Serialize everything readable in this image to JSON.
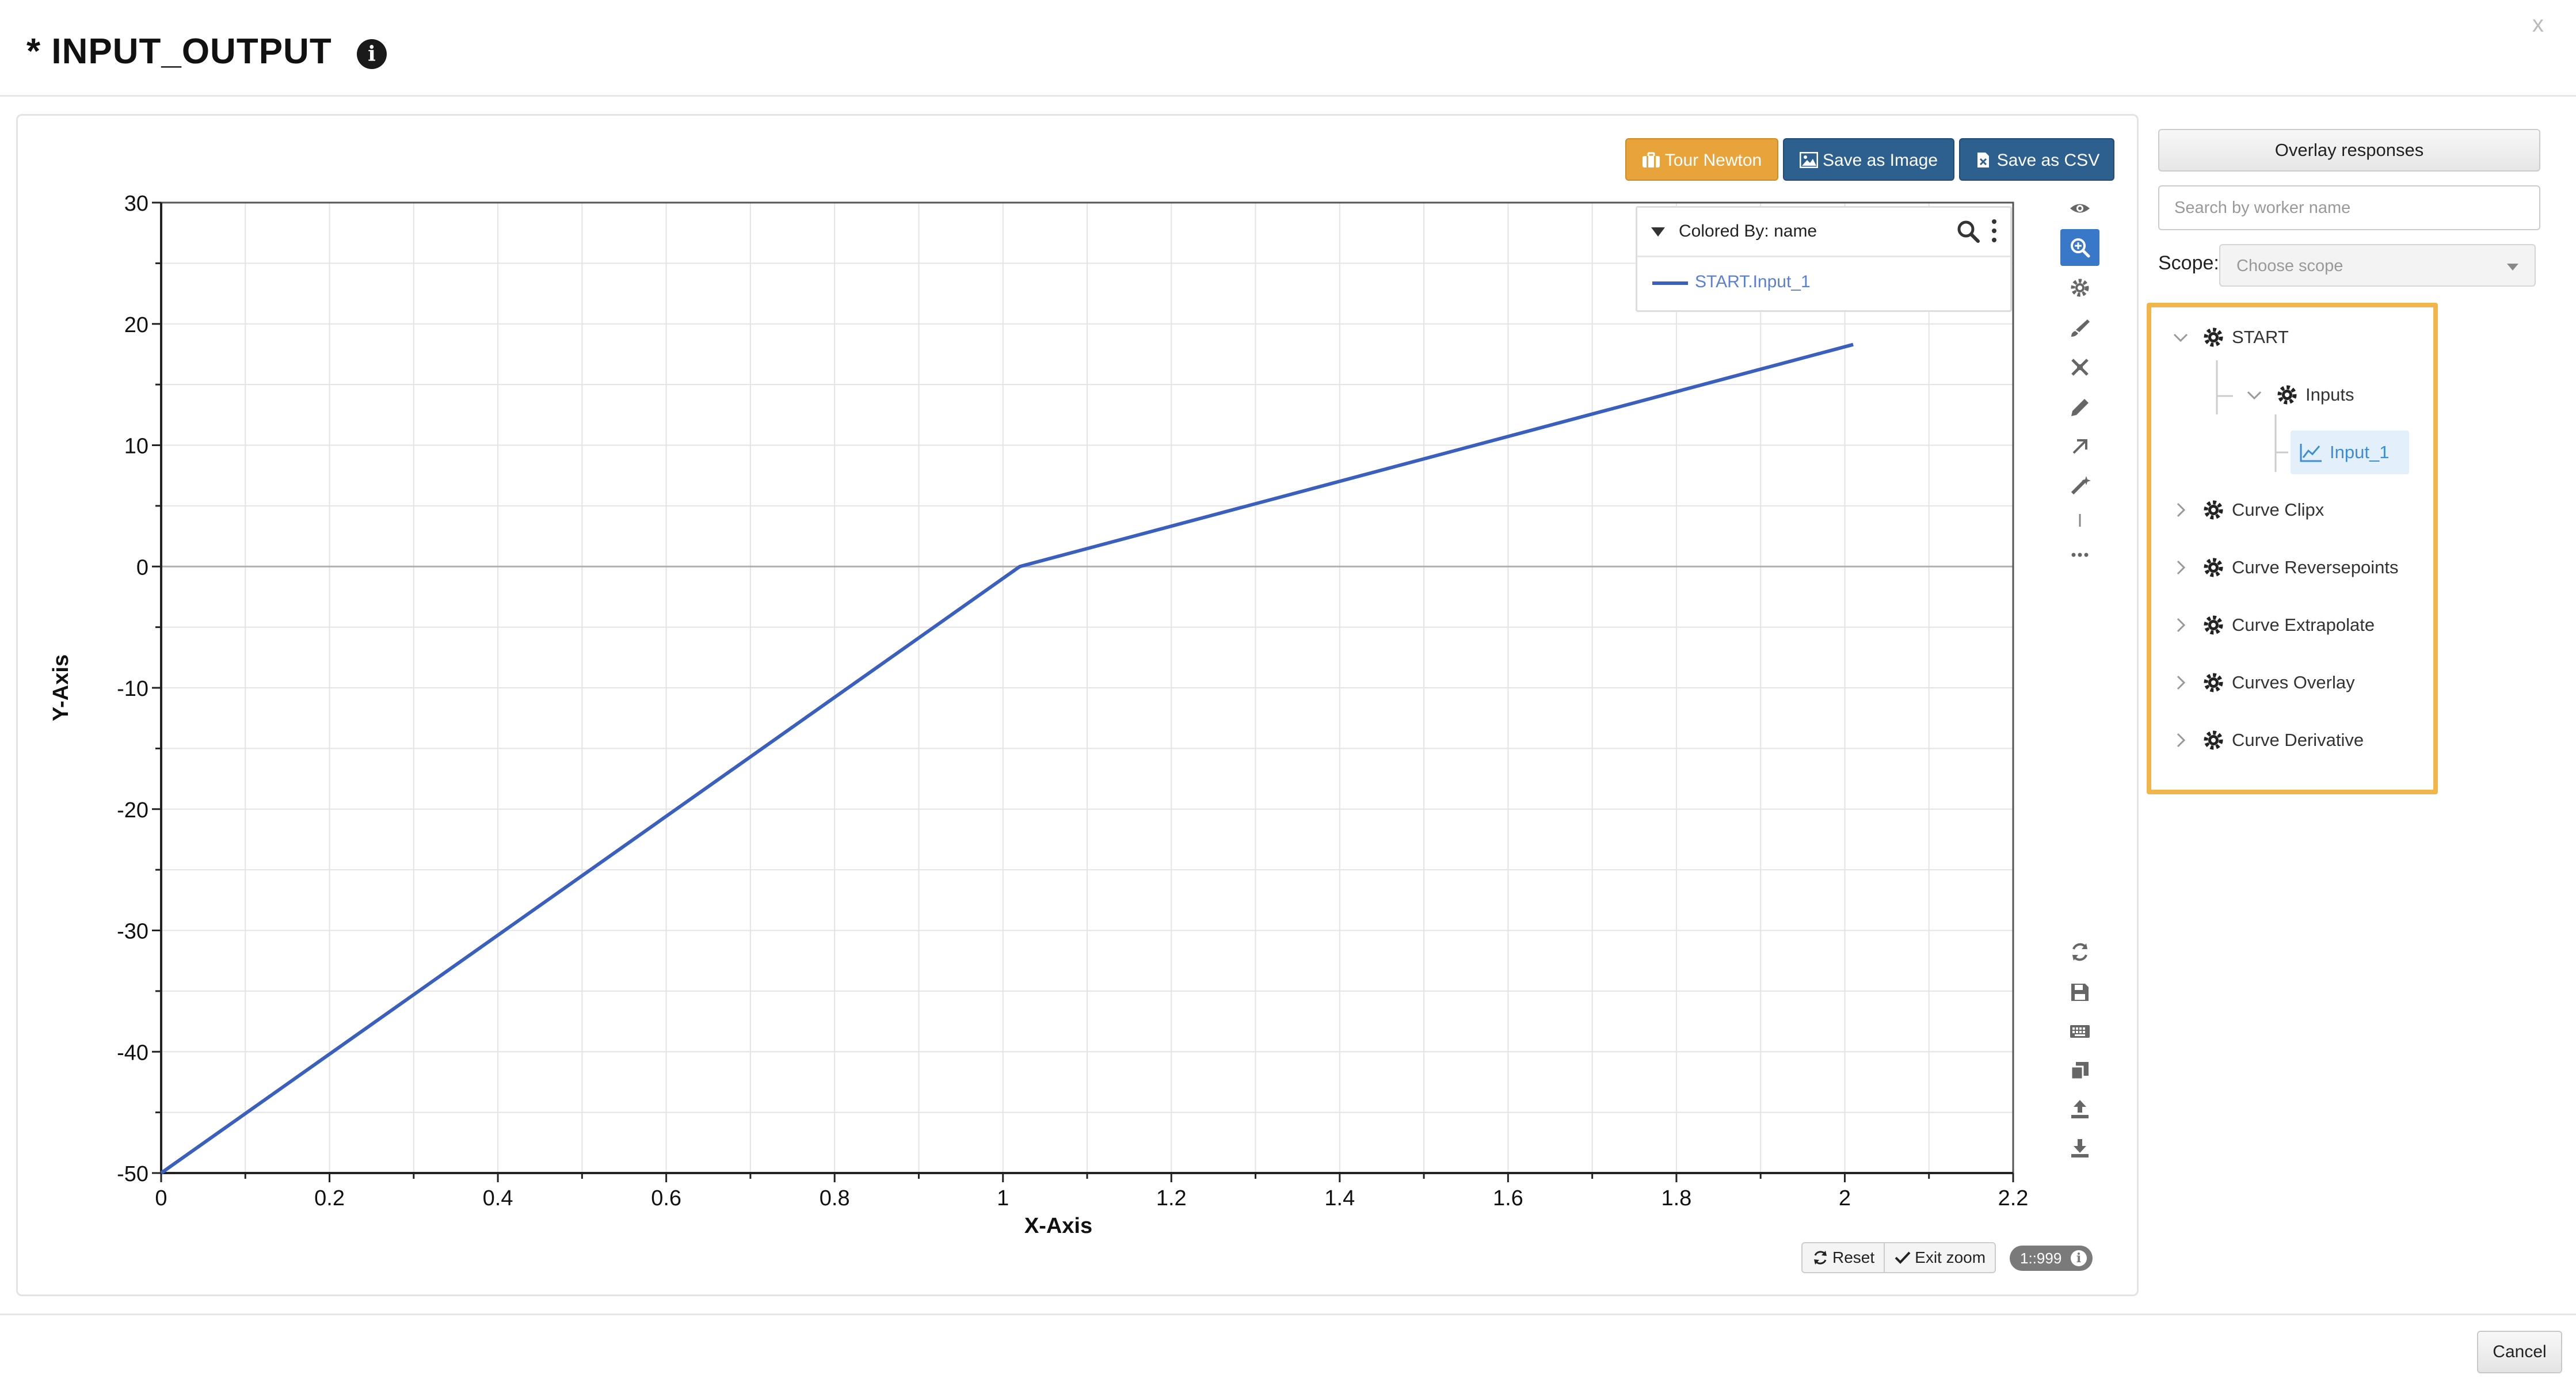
{
  "header": {
    "title": "* INPUT_OUTPUT",
    "info_glyph": "i",
    "close_label": "x"
  },
  "toolbar": {
    "tour_label": "Tour Newton",
    "save_image_label": "Save as Image",
    "save_csv_label": "Save as CSV"
  },
  "legend": {
    "title": "Colored By: name",
    "items": [
      {
        "label": "START.Input_1",
        "color": "#3a5fbf"
      }
    ]
  },
  "chart_controls": {
    "reset_label": "Reset",
    "exit_zoom_label": "Exit zoom",
    "ratio_label": "1::999"
  },
  "chart_data": {
    "type": "line",
    "xlabel": "X-Axis",
    "ylabel": "Y-Axis",
    "xlim": [
      0,
      2.2
    ],
    "ylim": [
      -50,
      30
    ],
    "xticks": [
      "0",
      "0.2",
      "0.4",
      "0.6",
      "0.8",
      "1",
      "1.2",
      "1.4",
      "1.6",
      "1.8",
      "2",
      "2.2"
    ],
    "yticks": [
      "30",
      "20",
      "10",
      "0",
      "-10",
      "-20",
      "-30",
      "-40",
      "-50"
    ],
    "grid": true,
    "legend_position": "top-right",
    "series": [
      {
        "name": "START.Input_1",
        "color": "#3a5fbf",
        "x": [
          0,
          1.02,
          2.01
        ],
        "y": [
          -50,
          0,
          18.3
        ]
      }
    ]
  },
  "vertical_tools": [
    {
      "name": "eye-icon"
    },
    {
      "name": "zoom-in-icon",
      "active": true
    },
    {
      "name": "gear-icon"
    },
    {
      "name": "brush-icon"
    },
    {
      "name": "fit-icon"
    },
    {
      "name": "pencil-icon"
    },
    {
      "name": "arrow-icon"
    },
    {
      "name": "magic-icon"
    },
    {
      "name": "separator-icon"
    },
    {
      "name": "more-icon"
    },
    {
      "name": "refresh-icon"
    },
    {
      "name": "save-icon"
    },
    {
      "name": "keyboard-icon"
    },
    {
      "name": "copy-icon"
    },
    {
      "name": "upload-icon"
    },
    {
      "name": "download-icon"
    }
  ],
  "right_panel": {
    "overlay_label": "Overlay responses",
    "search_placeholder": "Search by worker name",
    "scope_label": "Scope:",
    "scope_placeholder": "Choose scope",
    "tree": {
      "start": "START",
      "inputs": "Inputs",
      "input_1": "Input_1",
      "others": [
        "Curve Clipx",
        "Curve Reversepoints",
        "Curve Extrapolate",
        "Curves Overlay",
        "Curve Derivative"
      ]
    },
    "highlight_color": "#f2b54a"
  },
  "footer": {
    "cancel_label": "Cancel"
  },
  "colors": {
    "accent": "#e8a33b",
    "primary": "#2d5f8f",
    "series": "#3a5fbf",
    "active_tool": "#3978c9"
  }
}
